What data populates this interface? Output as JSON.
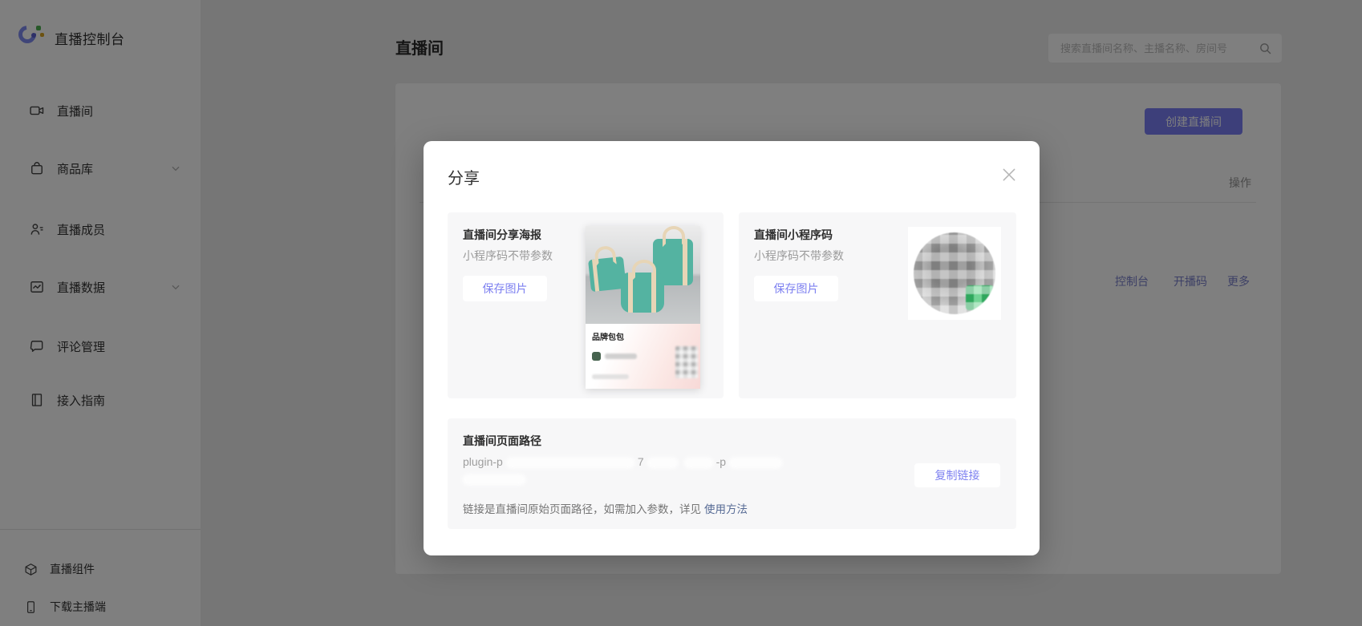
{
  "app": {
    "title": "直播控制台"
  },
  "sidebar": {
    "items": [
      {
        "label": "直播间",
        "icon": "video-camera-icon",
        "expandable": false
      },
      {
        "label": "商品库",
        "icon": "shopping-bag-icon",
        "expandable": true
      },
      {
        "label": "直播成员",
        "icon": "member-icon",
        "expandable": false
      },
      {
        "label": "直播数据",
        "icon": "chart-icon",
        "expandable": true
      },
      {
        "label": "评论管理",
        "icon": "comment-icon",
        "expandable": false
      },
      {
        "label": "接入指南",
        "icon": "guide-icon",
        "expandable": false
      }
    ],
    "footer_items": [
      {
        "label": "直播组件",
        "icon": "cube-icon"
      },
      {
        "label": "下载主播端",
        "icon": "phone-icon"
      }
    ]
  },
  "header": {
    "page_title": "直播间",
    "search_placeholder": "搜索直播间名称、主播名称、房间号"
  },
  "content": {
    "create_button": "创建直播间",
    "table_header_action": "操作",
    "row_actions": [
      "控制台",
      "开播码",
      "更多"
    ]
  },
  "modal": {
    "title": "分享",
    "poster_section": {
      "title": "直播间分享海报",
      "subtitle": "小程序码不带参数",
      "button": "保存图片",
      "poster_brand": "品牌包包"
    },
    "qrcode_section": {
      "title": "直播间小程序码",
      "subtitle": "小程序码不带参数",
      "button": "保存图片"
    },
    "path_section": {
      "title": "直播间页面路径",
      "path_prefix": "plugin-p",
      "path_mid": "7",
      "path_mid2": "-p",
      "note_text": "链接是直播间原始页面路径，如需加入参数，详见",
      "note_link": "使用方法",
      "copy_button": "复制链接"
    }
  },
  "colors": {
    "accent_purple": "#7a7ef5",
    "ghost_button_text": "#7d80f0",
    "link_blue": "#576b95",
    "mini_code_green": "#3ec06f",
    "overlay": "rgba(0,0,0,0.5)"
  }
}
